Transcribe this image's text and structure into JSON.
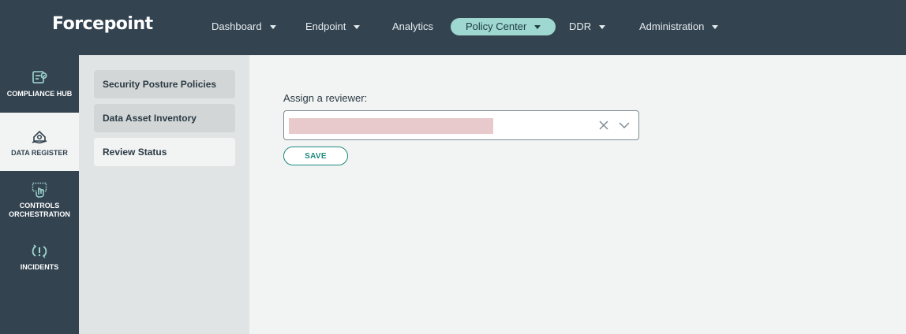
{
  "brand": {
    "logo_text": "Forcepoint"
  },
  "top_nav": {
    "items": [
      {
        "label": "Dashboard",
        "has_dropdown": true,
        "active": false
      },
      {
        "label": "Endpoint",
        "has_dropdown": true,
        "active": false
      },
      {
        "label": "Analytics",
        "has_dropdown": false,
        "active": false
      },
      {
        "label": "Policy Center",
        "has_dropdown": true,
        "active": true
      },
      {
        "label": "DDR",
        "has_dropdown": true,
        "active": false
      },
      {
        "label": "Administration",
        "has_dropdown": true,
        "active": false
      }
    ]
  },
  "left_nav": {
    "items": [
      {
        "label": "COMPLIANCE HUB",
        "icon": "compliance-hub-icon",
        "active": false
      },
      {
        "label": "DATA REGISTER",
        "icon": "data-register-icon",
        "active": true
      },
      {
        "label": "CONTROLS ORCHESTRATION",
        "icon": "controls-orchestration-icon",
        "active": false
      },
      {
        "label": "INCIDENTS",
        "icon": "incidents-icon",
        "active": false
      }
    ]
  },
  "sub_nav": {
    "items": [
      {
        "label": "Security Posture Policies",
        "active": false
      },
      {
        "label": "Data Asset Inventory",
        "active": false
      },
      {
        "label": "Review Status",
        "active": true
      }
    ]
  },
  "main": {
    "assign_label": "Assign a reviewer:",
    "reviewer_select": {
      "value": "",
      "redacted": true
    },
    "save_label": "SAVE"
  },
  "colors": {
    "header_bg": "#334350",
    "active_nav_bg": "#9fd8d0",
    "accent": "#1f8b7e",
    "redaction": "#e8cacc"
  }
}
